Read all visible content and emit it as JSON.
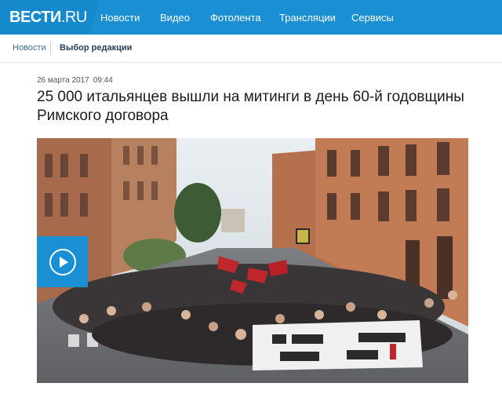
{
  "header": {
    "logo_main": "ВЕСТИ",
    "logo_suffix": ".RU",
    "nav": [
      "Новости",
      "Видео",
      "Фотолента",
      "Трансляции",
      "Сервисы"
    ],
    "bg_color": "#1a8fd3"
  },
  "breadcrumb": {
    "section": "Новости",
    "subsection": "Выбор редакции"
  },
  "article": {
    "date": "26 марта 2017",
    "time": "09:44",
    "title": "25 000 итальянцев вышли на митинги в день 60-й годовщины Римского договора"
  },
  "media": {
    "play_icon": "play-icon",
    "accent_color": "#1a8fd3"
  }
}
